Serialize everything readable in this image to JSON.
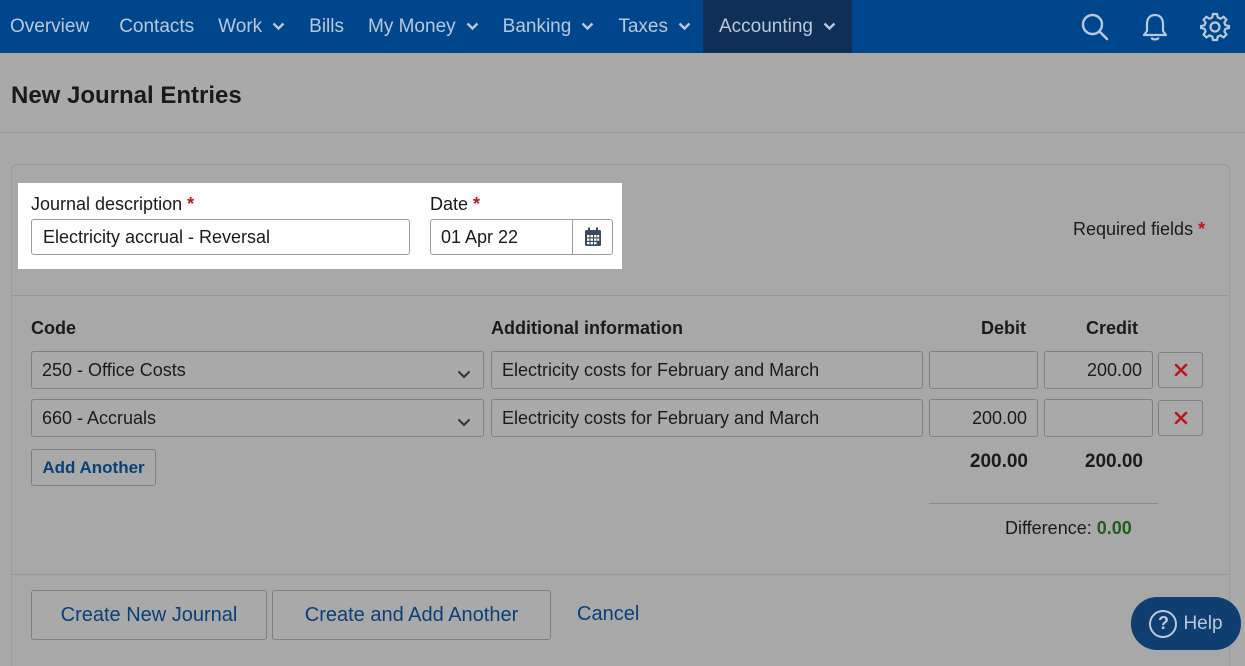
{
  "nav": {
    "items": [
      {
        "label": "Overview",
        "dropdown": false
      },
      {
        "label": "Contacts",
        "dropdown": false
      },
      {
        "label": "Work",
        "dropdown": true
      },
      {
        "label": "Bills",
        "dropdown": false
      },
      {
        "label": "My Money",
        "dropdown": true
      },
      {
        "label": "Banking",
        "dropdown": true
      },
      {
        "label": "Taxes",
        "dropdown": true
      },
      {
        "label": "Accounting",
        "dropdown": true,
        "active": true
      }
    ],
    "icons": [
      "search-icon",
      "bell-icon",
      "gear-icon"
    ]
  },
  "page": {
    "title": "New Journal Entries"
  },
  "form": {
    "description_label": "Journal description",
    "description_value": "Electricity accrual - Reversal",
    "date_label": "Date",
    "date_value": "01 Apr 22",
    "required_star": "*",
    "required_note": "Required fields"
  },
  "lines": {
    "headers": {
      "code": "Code",
      "info": "Additional information",
      "debit": "Debit",
      "credit": "Credit"
    },
    "rows": [
      {
        "code": "250 - Office Costs",
        "info": "Electricity costs for February and March",
        "debit": "",
        "credit": "200.00"
      },
      {
        "code": "660 - Accruals",
        "info": "Electricity costs for February and March",
        "debit": "200.00",
        "credit": ""
      }
    ],
    "add_another": "Add Another",
    "total_debit": "200.00",
    "total_credit": "200.00",
    "difference_label": "Difference:",
    "difference_value": "0.00"
  },
  "footer": {
    "create_new": "Create New Journal",
    "create_add": "Create and Add Another",
    "cancel": "Cancel"
  },
  "help": {
    "label": "Help",
    "symbol": "?"
  },
  "colors": {
    "nav_bg": "#00468c",
    "nav_active": "#0f2f57",
    "link_blue": "#0a3f78",
    "required_red": "#c1121f",
    "difference_green": "#1f5e1f"
  }
}
